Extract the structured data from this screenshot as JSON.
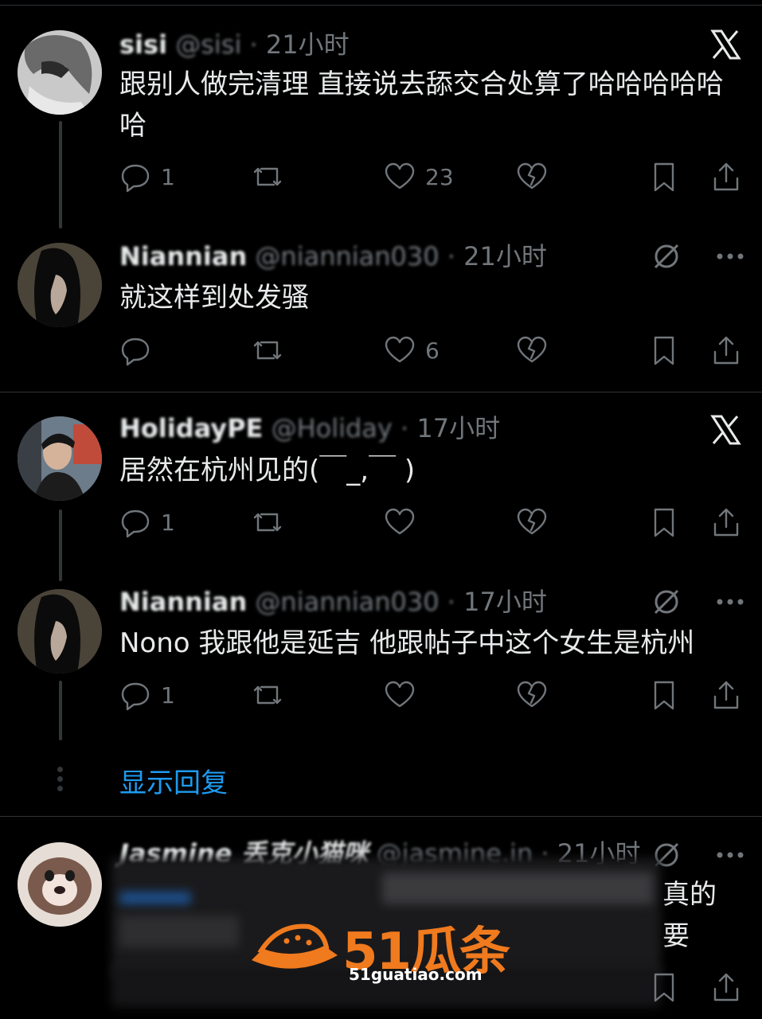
{
  "tweets": [
    {
      "name": "sisi",
      "handle": "@sisi ·",
      "time": "21小时",
      "text": "跟别人做完清理 直接说去舔交合处算了哈哈哈哈哈哈",
      "replies": "1",
      "likes": "23",
      "corner_icon": "x-logo-icon"
    },
    {
      "name": "Niannian",
      "handle": "@niannian030 ·",
      "time": "21小时",
      "text": "就这样到处发骚",
      "replies": "",
      "likes": "6",
      "corner_icon": "muted-icon"
    },
    {
      "name": "HolidayPE",
      "handle": "@Holiday ·",
      "time": "17小时",
      "text": "居然在杭州见的(￣_,￣ )",
      "replies": "1",
      "likes": "",
      "corner_icon": "x-logo-icon"
    },
    {
      "name": "Niannian",
      "handle": "@niannian030 ·",
      "time": "17小时",
      "text": "Nono 我跟他是延吉 他跟帖子中这个女生是杭州",
      "replies": "1",
      "likes": "",
      "corner_icon": "muted-icon"
    },
    {
      "name": "Jasmine 丢克小猫咪",
      "handle": "@jasmine.in ·",
      "time": "21小时",
      "text": "真的要",
      "replies": "",
      "likes": "",
      "corner_icon": "muted-icon"
    }
  ],
  "show_replies_label": "显示回复",
  "watermark": {
    "text": "51瓜条",
    "site": "51guatiao.com"
  },
  "colors": {
    "background": "#000000",
    "text": "#e7e9ea",
    "muted": "#71767b",
    "link": "#1d9bf0",
    "divider": "#2f3336",
    "watermark": "#f07a1e"
  }
}
